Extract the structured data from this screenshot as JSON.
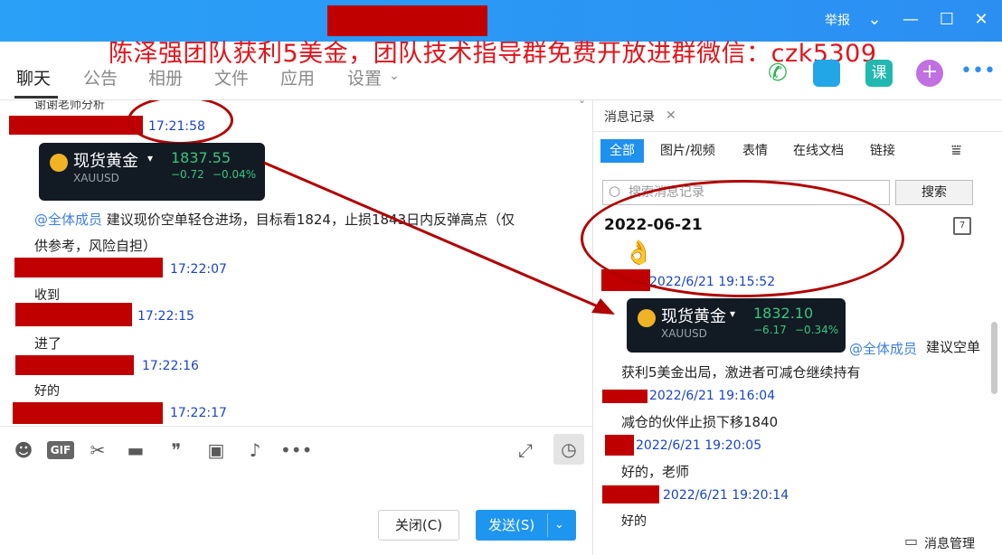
{
  "titlebar": {
    "report": "举报",
    "promo": "陈泽强团队获利5美金，团队技术指导群免费开放进群微信：czk5309"
  },
  "nav": {
    "tabs": [
      "聊天",
      "公告",
      "相册",
      "文件",
      "应用",
      "设置"
    ],
    "lesson_icon": "课"
  },
  "chat": {
    "top_text": "谢谢老师分析",
    "t1": "17:21:58",
    "gold1": {
      "name": "现货黄金",
      "code": "XAUUSD",
      "price": "1837.55",
      "chg": "−0.72",
      "pct": "−0.04%"
    },
    "msg1_at": "@全体成员",
    "msg1": " 建议现价空单轻仓进场，目标看1824，止损1843日内反弹高点（仅",
    "msg1b": "供参考，风险自担）",
    "t2": "17:22:07",
    "m2": "收到",
    "t3": "17:22:15",
    "m3": "进了",
    "t4": "17:22:16",
    "m4": "好的",
    "t5": "17:22:17"
  },
  "toolbar": {
    "gif": "GIF",
    "close": "关闭(C)",
    "send": "发送(S)"
  },
  "panel": {
    "tab": "消息记录",
    "filters": [
      "全部",
      "图片/视频",
      "表情",
      "在线文档",
      "链接"
    ],
    "search_placeholder": "搜索消息记录",
    "search_btn": "搜索",
    "date": "2022-06-21",
    "cal_num": "7",
    "pt1": "2022/6/21 19:15:52",
    "gold2": {
      "name": "现货黄金",
      "code": "XAUUSD",
      "price": "1832.10",
      "chg": "−6.17",
      "pct": "−0.34%"
    },
    "p_at": "@全体成员",
    "p_at_text": "建议空单",
    "pm1": "获利5美金出局，激进者可减仓继续持有",
    "pt2": "2022/6/21 19:16:04",
    "pm2": "减仓的伙伴止损下移1840",
    "pt3": "2022/6/21 19:20:05",
    "pm3": "好的，老师",
    "pt4": "2022/6/21 19:20:14",
    "pm4": "好的",
    "manage": "消息管理"
  },
  "colors": {
    "accent": "#1e96f0",
    "redact": "#c00000",
    "annotation": "#b20000"
  }
}
